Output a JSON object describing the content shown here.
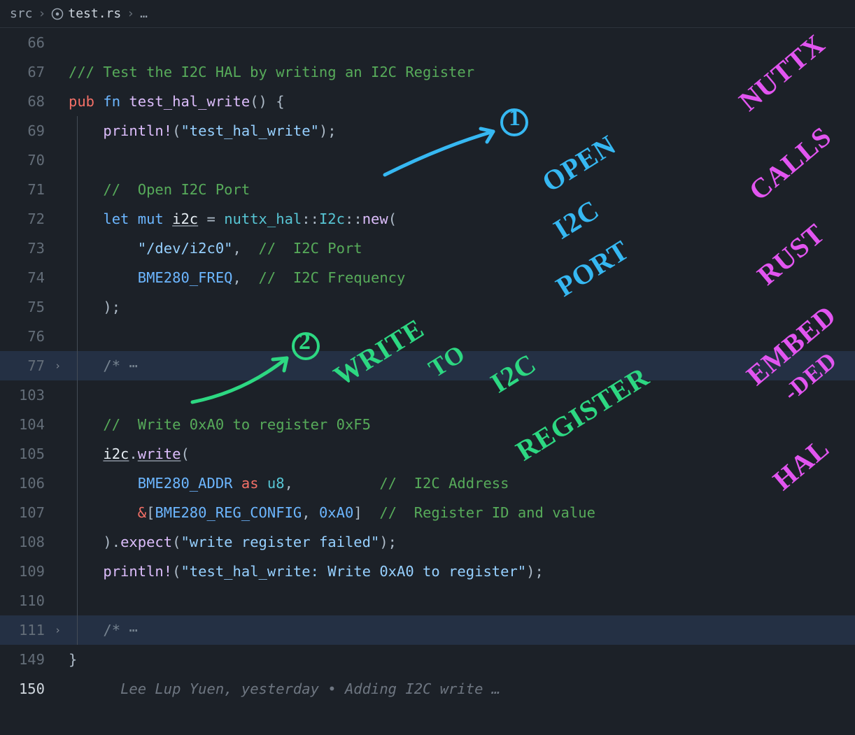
{
  "breadcrumb": {
    "folder": "src",
    "file": "test.rs",
    "tail": "…"
  },
  "lines": {
    "l66": "66",
    "l67": "67",
    "l68": "68",
    "l69": "69",
    "l70": "70",
    "l71": "71",
    "l72": "72",
    "l73": "73",
    "l74": "74",
    "l75": "75",
    "l76": "76",
    "l77": "77",
    "l103": "103",
    "l104": "104",
    "l105": "105",
    "l106": "106",
    "l107": "107",
    "l108": "108",
    "l109": "109",
    "l110": "110",
    "l111": "111",
    "l149": "149",
    "l150": "150"
  },
  "code": {
    "doc": "/// Test the I2C HAL by writing an I2C Register",
    "pub": "pub",
    "fn": "fn",
    "name": "test_hal_write",
    "sigrest": "() {",
    "println": "println!",
    "s1": "\"test_hal_write\"",
    "close_p": ");",
    "c_open": "//  Open I2C Port",
    "let": "let",
    "mut": "mut",
    "i2c": "i2c",
    "eq": " = ",
    "mod": "nuttx_hal",
    "cc": "::",
    "ty_i2c": "I2c",
    "new": "new",
    "lpar": "(",
    "s_port": "\"/dev/i2c0\"",
    "comma": ",",
    "c_port": "//  I2C Port",
    "const_freq": "BME280_FREQ",
    "c_freq": "//  I2C Frequency",
    "close_call": ");",
    "fold1": "/* ⋯",
    "c_write": "//  Write 0xA0 to register 0xF5",
    "i2c2": "i2c",
    "dot": ".",
    "write": "write",
    "const_addr": "BME280_ADDR",
    "as": "as",
    "u8": "u8",
    "c_addr": "//  I2C Address",
    "amp": "&",
    "lbr": "[",
    "const_cfg": "BME280_REG_CONFIG",
    "hex": "0xA0",
    "rbr": "]",
    "c_regval": "//  Register ID and value",
    "expect_pre": ").",
    "expect": "expect",
    "s_fail": "\"write register failed\"",
    "s2": "\"test_hal_write: Write 0xA0 to register\"",
    "fold2": "/* ⋯",
    "closebrace": "}",
    "lens": "Lee Lup Yuen, yesterday • Adding I2C write …"
  },
  "annotations": {
    "open1": "OPEN",
    "open2": "I2C",
    "open3": "PORT",
    "num1": "1",
    "write1": "WRITE",
    "write2": "TO",
    "write3": "I2C",
    "write4": "REGISTER",
    "num2": "2",
    "nuttx": "NUTTX",
    "calls": "CALLS",
    "rust": "RUST",
    "emb1": "EMBED",
    "emb2": "-DED",
    "hal": "HAL"
  }
}
